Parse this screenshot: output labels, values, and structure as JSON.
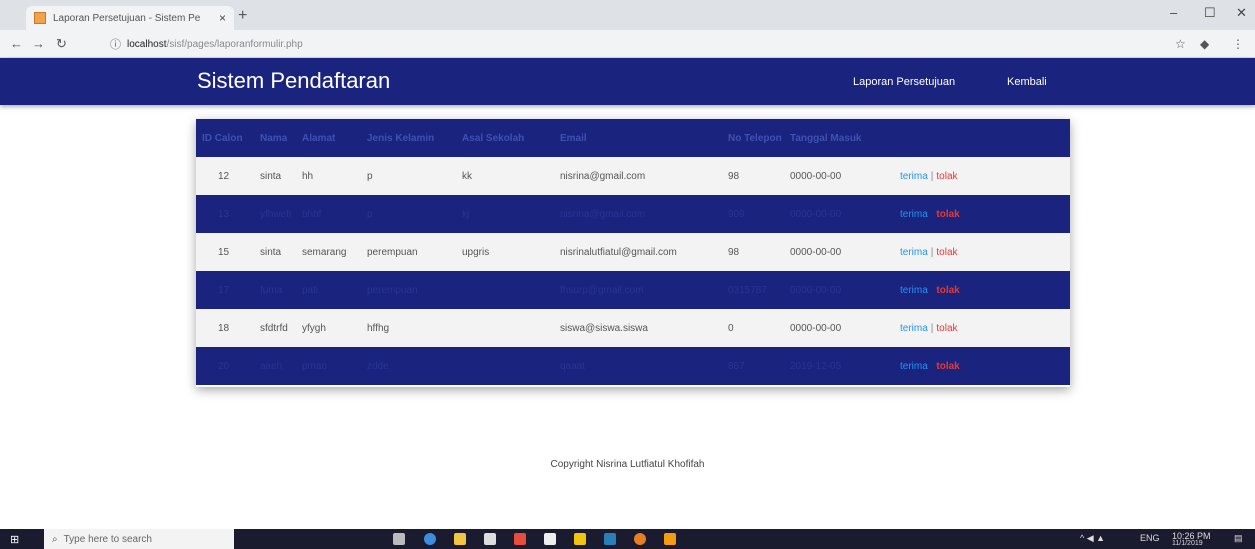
{
  "browser": {
    "tab_title": "Laporan Persetujuan - Sistem Pe",
    "tab_close": "×",
    "new_tab": "+",
    "url_host": "localhost",
    "url_path": "/sisf/pages/laporanformulir.php",
    "win_min": "–",
    "win_max": "☐",
    "win_close": "✕"
  },
  "app": {
    "brand": "Sistem Pendaftaran",
    "nav": [
      "Laporan Persetujuan",
      "Kembali"
    ]
  },
  "table": {
    "columns": [
      "ID Calon",
      "Nama",
      "Alamat",
      "Jenis Kelamin",
      "Asal Sekolah",
      "Email",
      "No Telepon",
      "Tanggal Masuk",
      ""
    ],
    "rows": [
      {
        "id": "12",
        "nama": "sinta",
        "alamat": "hh",
        "jk": "p",
        "asal": "kk",
        "email": "nisrina@gmail.com",
        "telp": "98",
        "tgl": "0000-00-00",
        "style": "light"
      },
      {
        "id": "13",
        "nama": "yfhwefr",
        "alamat": "bhhf",
        "jk": "p",
        "asal": "kj",
        "email": "nisrina@gmail.com",
        "telp": "909",
        "tgl": "0000-00-00",
        "style": "dark"
      },
      {
        "id": "15",
        "nama": "sinta",
        "alamat": "semarang",
        "jk": "perempuan",
        "asal": "upgris",
        "email": "nisrinalutfiatul@gmail.com",
        "telp": "98",
        "tgl": "0000-00-00",
        "style": "light"
      },
      {
        "id": "17",
        "nama": "fuma",
        "alamat": "pati",
        "jk": "perempuan",
        "asal": "",
        "email": "fhsurp@gmail.com",
        "telp": "0315787",
        "tgl": "0000-00-00",
        "style": "dark"
      },
      {
        "id": "18",
        "nama": "sfdtrfd",
        "alamat": "yfygh",
        "jk": "hffhg",
        "asal": "",
        "email": "siswa@siswa.siswa",
        "telp": "0",
        "tgl": "0000-00-00",
        "style": "light"
      },
      {
        "id": "20",
        "nama": "aaeh",
        "alamat": "pmao",
        "jk": "zdde",
        "asal": "",
        "email": "qaaat",
        "telp": "867",
        "tgl": "2019-12-05",
        "style": "dark"
      }
    ],
    "action_accept": "terima",
    "action_sep": "|",
    "action_reject": "tolak"
  },
  "footer": "Copyright Nisrina Lutfiatul Khofifah",
  "taskbar": {
    "search_placeholder": "Type here to search",
    "lang": "ENG",
    "time": "10:26 PM",
    "date": "11/1/2019"
  }
}
